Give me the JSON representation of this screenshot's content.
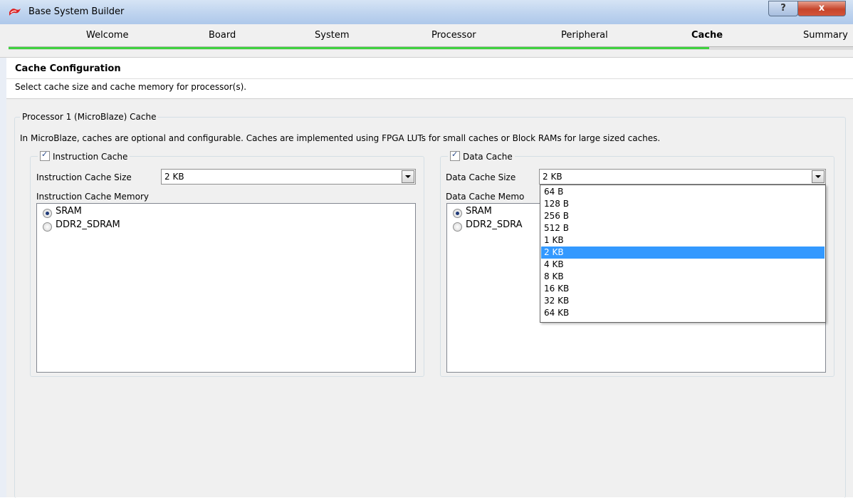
{
  "window": {
    "title": "Base System Builder",
    "help_label": "?",
    "close_label": "x"
  },
  "wizard": {
    "steps": [
      {
        "label": "Welcome"
      },
      {
        "label": "Board"
      },
      {
        "label": "System"
      },
      {
        "label": "Processor"
      },
      {
        "label": "Peripheral"
      },
      {
        "label": "Cache"
      },
      {
        "label": "Summary"
      }
    ],
    "active_step": "Cache",
    "progress": 0.83,
    "progress_color": "#3fd13f"
  },
  "header": {
    "title": "Cache Configuration",
    "description": "Select cache size and cache memory for processor(s)."
  },
  "processor_group": {
    "title": "Processor 1 (MicroBlaze) Cache",
    "description": "In MicroBlaze, caches are optional and configurable. Caches are implemented using FPGA LUTs for small caches or Block RAMs for large sized caches."
  },
  "instruction_cache": {
    "enabled": true,
    "label": "Instruction Cache",
    "size_label": "Instruction Cache Size",
    "size_value": "2 KB",
    "memory_label": "Instruction Cache Memory",
    "memory_options": [
      "SRAM",
      "DDR2_SDRAM"
    ],
    "memory_selected": "SRAM"
  },
  "data_cache": {
    "enabled": true,
    "label": "Data Cache",
    "size_label": "Data Cache Size",
    "size_value": "2 KB",
    "memory_label_visible": "Data Cache Memo",
    "memory_options_visible": [
      "SRAM",
      "DDR2_SDRA"
    ],
    "memory_selected": "SRAM",
    "size_options": [
      "64 B",
      "128 B",
      "256 B",
      "512 B",
      "1 KB",
      "2 KB",
      "4 KB",
      "8 KB",
      "16 KB",
      "32 KB",
      "64 KB"
    ],
    "size_selected": "2 KB"
  },
  "colors": {
    "selection": "#3399ff",
    "titlebar": "#bcd2ee",
    "close": "#c6452b"
  }
}
